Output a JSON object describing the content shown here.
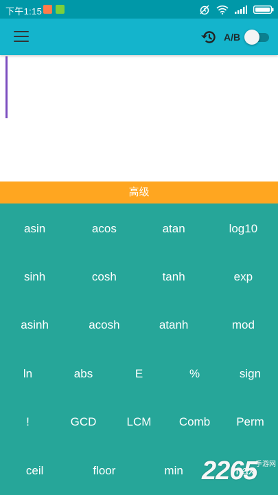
{
  "status_bar": {
    "time": "下午1:15",
    "icons": [
      "mail-notification-icon",
      "app-notification-icon",
      "alarm-icon",
      "wifi-icon",
      "signal-icon",
      "battery-icon"
    ]
  },
  "app_bar": {
    "menu_icon": "menu-icon",
    "history_icon": "history-icon",
    "ab_label": "A/B",
    "ab_toggle_on": false
  },
  "display": {
    "expression": ""
  },
  "mode_bar": {
    "label": "高级"
  },
  "keypad": {
    "rows": [
      [
        "asin",
        "acos",
        "atan",
        "log10"
      ],
      [
        "sinh",
        "cosh",
        "tanh",
        "exp"
      ],
      [
        "asinh",
        "acosh",
        "atanh",
        "mod"
      ],
      [
        "ln",
        "abs",
        "E",
        "%",
        "sign"
      ],
      [
        "!",
        "GCD",
        "LCM",
        "Comb",
        "Perm"
      ],
      [
        "ceil",
        "floor",
        "min",
        "max"
      ]
    ]
  },
  "watermark": {
    "number": "2265",
    "text": "手游网"
  },
  "colors": {
    "status_bar": "#0098a8",
    "app_bar": "#14b4cc",
    "mode_bar": "#ffa620",
    "keypad": "#26a699",
    "cursor": "#7b4dbf"
  }
}
